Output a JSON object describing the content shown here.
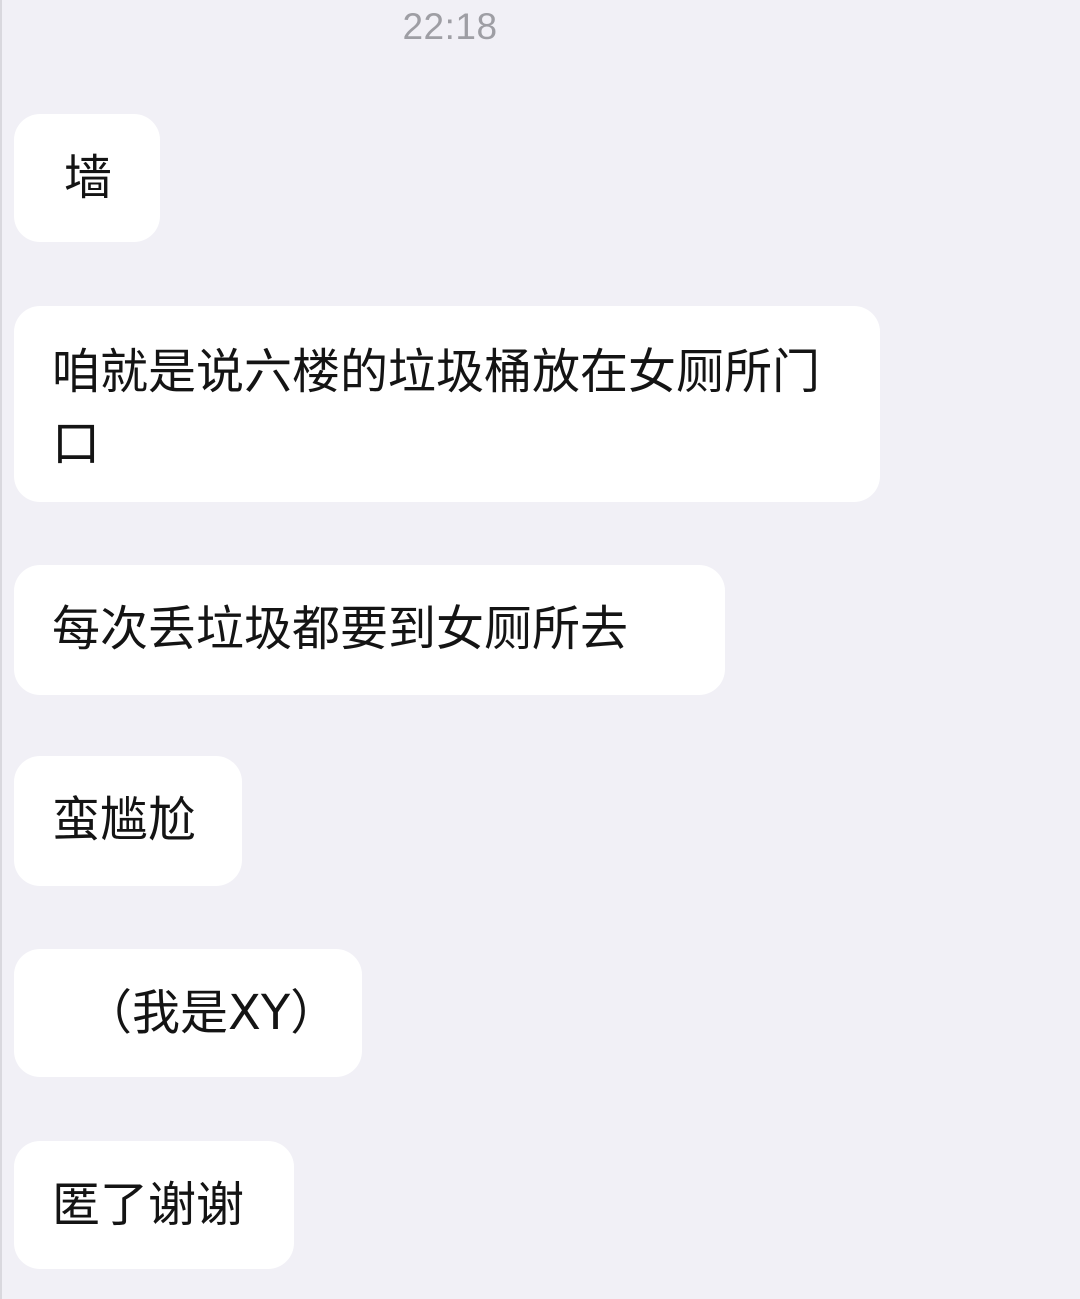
{
  "timestamp": "22:18",
  "messages": [
    {
      "text": "墙"
    },
    {
      "text": "咱就是说六楼的垃圾桶放在女厕所门口"
    },
    {
      "text": "每次丢垃圾都要到女厕所去"
    },
    {
      "text": "蛮尴尬"
    },
    {
      "text": "（我是XY）"
    },
    {
      "text": "匿了谢谢"
    }
  ]
}
